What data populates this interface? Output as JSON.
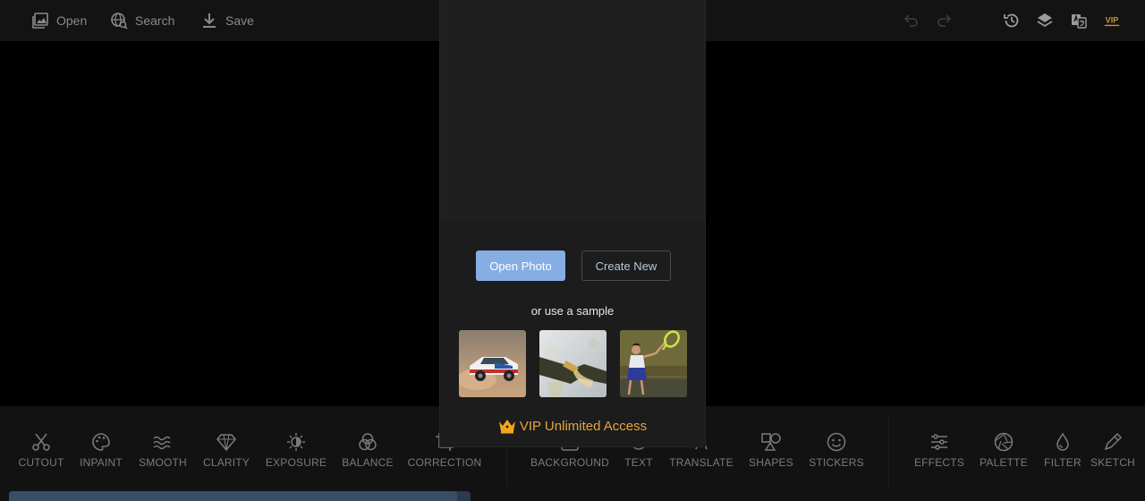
{
  "topbar": {
    "open_label": "Open",
    "search_label": "Search",
    "save_label": "Save",
    "vip_badge": "VIP"
  },
  "dialog": {
    "open_photo_label": "Open Photo",
    "create_new_label": "Create New",
    "sample_text": "or use a sample",
    "vip_text": "VIP Unlimited Access"
  },
  "tools": {
    "cutout": "CUTOUT",
    "inpaint": "INPAINT",
    "smooth": "SMOOTH",
    "clarity": "CLARITY",
    "exposure": "EXPOSURE",
    "balance": "BALANCE",
    "correction": "CORRECTION",
    "background": "BACKGROUND",
    "text": "TEXT",
    "translate": "TRANSLATE",
    "shapes": "SHAPES",
    "stickers": "STICKERS",
    "effects": "EFFECTS",
    "palette": "PALETTE",
    "filter": "FILTER",
    "sketch": "SKETCH"
  },
  "icons": {
    "open": "image-icon",
    "search": "globe-search-icon",
    "save": "download-icon",
    "undo": "undo-icon",
    "redo": "redo-icon",
    "history": "history-icon",
    "layers": "layers-icon",
    "language": "translate-icon",
    "vip": "vip-icon",
    "crown": "crown-icon"
  },
  "colors": {
    "accent": "#86aee4",
    "vip": "#e8a53a",
    "background": "#000000",
    "toolbar": "#131313",
    "dialog": "#1c1c1c"
  },
  "progress": 0.97
}
